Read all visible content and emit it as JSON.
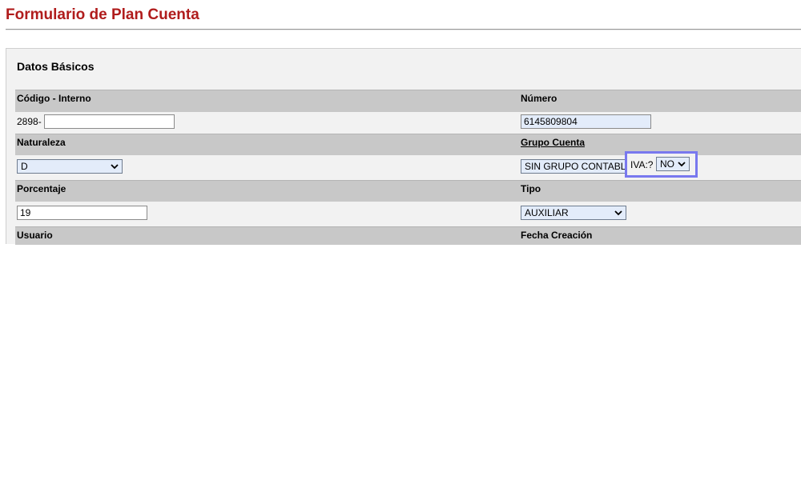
{
  "page": {
    "title": "Formulario de Plan Cuenta"
  },
  "section": {
    "title": "Datos Básicos"
  },
  "fields": {
    "codigo": {
      "label": "Código - Interno",
      "prefix": "2898-",
      "value": ""
    },
    "numero": {
      "label": "Número",
      "value": "6145809804"
    },
    "naturaleza": {
      "label": "Naturaleza",
      "selected": "D"
    },
    "grupo_cuenta": {
      "label": "Grupo Cuenta",
      "selected": "SIN GRUPO CONTABLE"
    },
    "porcentaje": {
      "label": "Porcentaje",
      "value": "19"
    },
    "tipo": {
      "label": "Tipo",
      "selected": "AUXILIAR"
    },
    "iva": {
      "label": "IVA:?",
      "selected": "NO"
    },
    "usuario": {
      "label": "Usuario"
    },
    "fecha_creacion": {
      "label": "Fecha Creación"
    }
  },
  "colors": {
    "title": "#b01c1c",
    "header_bg": "#c8c8c8",
    "panel_bg": "#f2f2f2",
    "select_bg": "#e3ecfa",
    "focus_outline": "#7878ee"
  },
  "icons": {
    "select_arrow": "chevron-down-icon"
  }
}
